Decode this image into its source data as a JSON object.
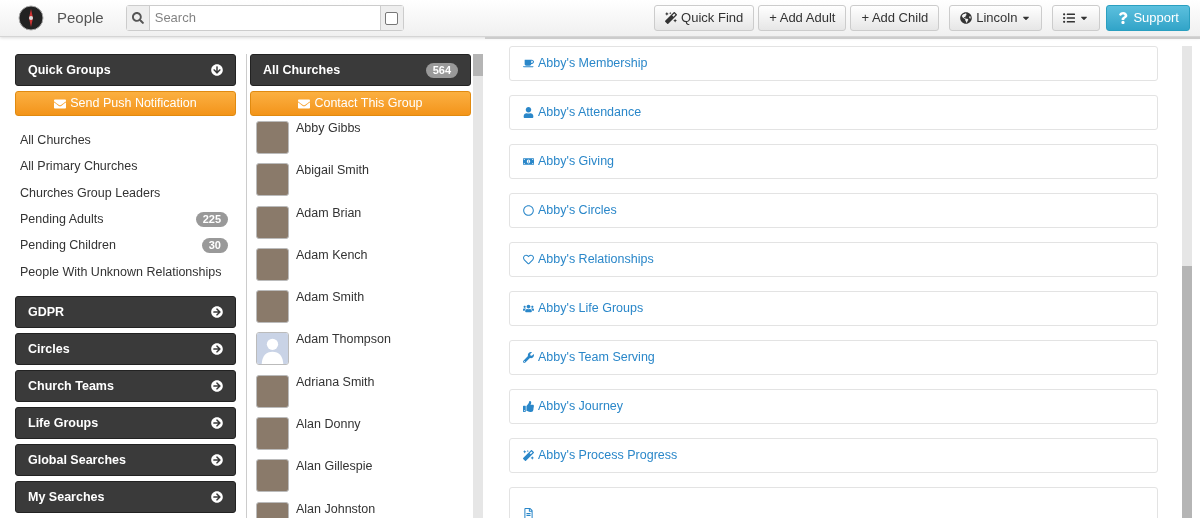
{
  "header": {
    "title": "People",
    "search": {
      "placeholder": "Search",
      "checked": false
    },
    "buttons": [
      {
        "kind": "quickfind",
        "label": "Quick Find"
      },
      {
        "kind": "add",
        "label": "+ Add Adult"
      },
      {
        "kind": "add",
        "label": "+ Add Child"
      },
      {
        "kind": "location",
        "label": "Lincoln"
      },
      {
        "kind": "list"
      },
      {
        "kind": "support",
        "label": "Support"
      }
    ]
  },
  "sidebar": {
    "sections": [
      {
        "title": "Quick Groups",
        "expanded": true,
        "action": "Send Push Notification",
        "items": [
          {
            "label": "All Churches"
          },
          {
            "label": "All Primary Churches"
          },
          {
            "label": "Churches Group Leaders"
          },
          {
            "label": "Pending Adults",
            "count": "225"
          },
          {
            "label": "Pending Children",
            "count": "30"
          },
          {
            "label": "People With Unknown Relationships"
          }
        ]
      },
      {
        "title": "GDPR",
        "expanded": false
      },
      {
        "title": "Circles",
        "expanded": false
      },
      {
        "title": "Church Teams",
        "expanded": false
      },
      {
        "title": "Life Groups",
        "expanded": false
      },
      {
        "title": "Global Searches",
        "expanded": false
      },
      {
        "title": "My Searches",
        "expanded": false
      }
    ]
  },
  "people": {
    "title": "All Churches",
    "count": "564",
    "action": "Contact This Group",
    "rows": [
      {
        "name": "Abby Gibbs",
        "kind": "photo"
      },
      {
        "name": "Abigail Smith",
        "kind": "photo"
      },
      {
        "name": "Adam Brian",
        "kind": "photo"
      },
      {
        "name": "Adam Kench",
        "kind": "photo"
      },
      {
        "name": "Adam Smith",
        "kind": "photo"
      },
      {
        "name": "Adam Thompson",
        "kind": "silhouette"
      },
      {
        "name": "Adriana Smith",
        "kind": "photo"
      },
      {
        "name": "Alan Donny",
        "kind": "photo"
      },
      {
        "name": "Alan Gillespie",
        "kind": "photo"
      },
      {
        "name": "Alan Johnston",
        "kind": "photo"
      }
    ]
  },
  "detail": {
    "cards": [
      {
        "label": "Abby's Membership"
      },
      {
        "label": "Abby's Attendance"
      },
      {
        "label": "Abby's Giving"
      },
      {
        "label": "Abby's Circles"
      },
      {
        "label": "Abby's Relationships"
      },
      {
        "label": "Abby's Life Groups"
      },
      {
        "label": "Abby's Team Serving"
      },
      {
        "label": "Abby's Journey"
      },
      {
        "label": "Abby's Process Progress"
      }
    ]
  }
}
